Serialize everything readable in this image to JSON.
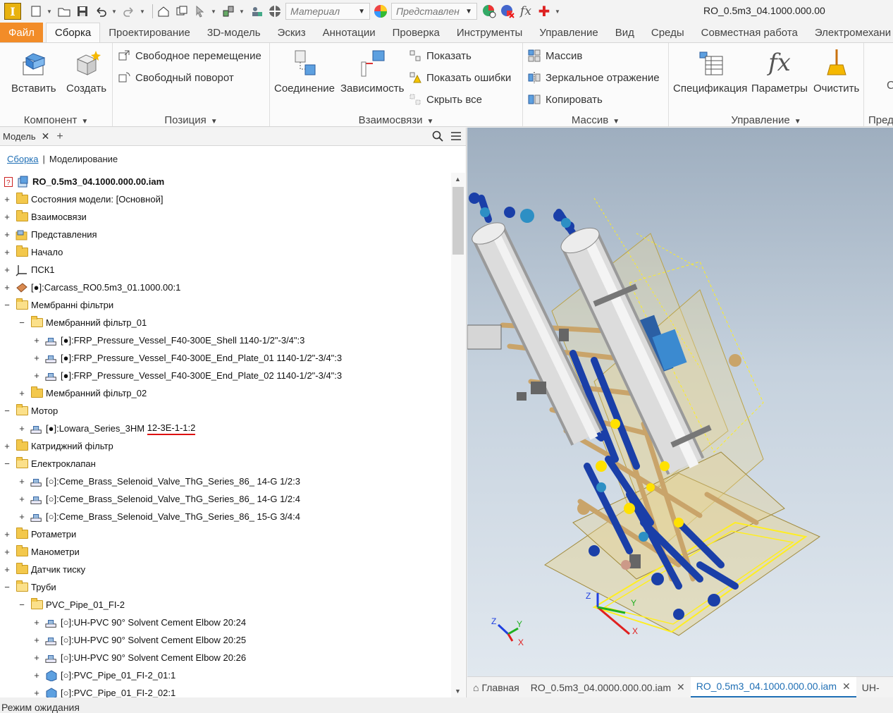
{
  "qat": {
    "material_placeholder": "Материал",
    "representation_placeholder": "Представлен",
    "document_title": "RO_0.5m3_04.1000.000.00"
  },
  "ribbon_tabs": [
    "Файл",
    "Сборка",
    "Проектирование",
    "3D-модель",
    "Эскиз",
    "Аннотации",
    "Проверка",
    "Инструменты",
    "Управление",
    "Вид",
    "Среды",
    "Совместная работа",
    "Электромехани"
  ],
  "ribbon": {
    "component": {
      "insert": "Вставить",
      "create": "Создать",
      "label": "Компонент"
    },
    "position": {
      "free_move": "Свободное перемещение",
      "free_rotate": "Свободный поворот",
      "label": "Позиция"
    },
    "relationships": {
      "joint": "Соединение",
      "constraint": "Зависимость",
      "show": "Показать",
      "show_errors": "Показать ошибки",
      "hide_all": "Скрыть все",
      "label": "Взаимосвязи"
    },
    "pattern": {
      "array": "Массив",
      "mirror": "Зеркальное отражение",
      "copy": "Копировать",
      "label": "Массив"
    },
    "manage": {
      "bom": "Спецификация",
      "params": "Параметры",
      "clean": "Очистить",
      "label": "Управление"
    },
    "next_group_label": "Пред"
  },
  "browser": {
    "tab": "Модель",
    "subtab_assembly": "Сборка",
    "subtab_modeling": "Моделирование",
    "tree": [
      {
        "label": "RO_0.5m3_04.1000.000.00.iam",
        "level": 0,
        "icon": "assembly",
        "exp": "none",
        "root": true
      },
      {
        "label": "Состояния модели: [Основной]",
        "level": 0,
        "icon": "folder",
        "exp": "plus"
      },
      {
        "label": "Взаимосвязи",
        "level": 0,
        "icon": "folder",
        "exp": "plus"
      },
      {
        "label": "Представления",
        "level": 0,
        "icon": "folder-views",
        "exp": "plus"
      },
      {
        "label": "Начало",
        "level": 0,
        "icon": "folder",
        "exp": "plus"
      },
      {
        "label": "ПСК1",
        "level": 0,
        "icon": "ucs",
        "exp": "plus"
      },
      {
        "label": "[●]:Carcass_RO0.5m3_01.1000.00:1",
        "level": 0,
        "icon": "part-frame",
        "exp": "plus"
      },
      {
        "label": "Мембранні фільтри",
        "level": 0,
        "icon": "folder-open",
        "exp": "minus"
      },
      {
        "label": "Мембранний фільтр_01",
        "level": 1,
        "icon": "folder-open",
        "exp": "minus"
      },
      {
        "label": "[●]:FRP_Pressure_Vessel_F40-300E_Shell 1140-1/2\"-3/4\":3",
        "level": 2,
        "icon": "cc-part",
        "exp": "plus"
      },
      {
        "label": "[●]:FRP_Pressure_Vessel_F40-300E_End_Plate_01 1140-1/2\"-3/4\":3",
        "level": 2,
        "icon": "cc-part",
        "exp": "plus"
      },
      {
        "label": "[●]:FRP_Pressure_Vessel_F40-300E_End_Plate_02 1140-1/2\"-3/4\":3",
        "level": 2,
        "icon": "cc-part",
        "exp": "plus"
      },
      {
        "label": "Мембранний фільтр_02",
        "level": 1,
        "icon": "folder",
        "exp": "plus"
      },
      {
        "label": "Мотор",
        "level": 0,
        "icon": "folder-open",
        "exp": "minus"
      },
      {
        "label_a": "[●]:Lowara_Series_3HM ",
        "label_b": "12-3E-1-1:2",
        "level": 1,
        "icon": "cc-part",
        "exp": "plus",
        "underline": true
      },
      {
        "label": "Катриджний фільтр",
        "level": 0,
        "icon": "folder",
        "exp": "plus"
      },
      {
        "label": "Електроклапан",
        "level": 0,
        "icon": "folder-open",
        "exp": "minus"
      },
      {
        "label": "[○]:Ceme_Brass_Selenoid_Valve_ThG_Series_86_ 14-G 1/2:3",
        "level": 1,
        "icon": "cc-part",
        "exp": "plus"
      },
      {
        "label": "[○]:Ceme_Brass_Selenoid_Valve_ThG_Series_86_ 14-G 1/2:4",
        "level": 1,
        "icon": "cc-part",
        "exp": "plus"
      },
      {
        "label": "[○]:Ceme_Brass_Selenoid_Valve_ThG_Series_86_ 15-G 3/4:4",
        "level": 1,
        "icon": "cc-part",
        "exp": "plus"
      },
      {
        "label": "Ротаметри",
        "level": 0,
        "icon": "folder",
        "exp": "plus"
      },
      {
        "label": "Манометри",
        "level": 0,
        "icon": "folder",
        "exp": "plus"
      },
      {
        "label": "Датчик тиску",
        "level": 0,
        "icon": "folder",
        "exp": "plus"
      },
      {
        "label": "Труби",
        "level": 0,
        "icon": "folder-open",
        "exp": "minus"
      },
      {
        "label": "PVC_Pipe_01_FI-2",
        "level": 1,
        "icon": "folder-open",
        "exp": "minus"
      },
      {
        "label": "[○]:UH-PVC 90° Solvent Cement Elbow 20:24",
        "level": 2,
        "icon": "cc-part",
        "exp": "plus"
      },
      {
        "label": "[○]:UH-PVC 90° Solvent Cement Elbow 20:25",
        "level": 2,
        "icon": "cc-part",
        "exp": "plus"
      },
      {
        "label": "[○]:UH-PVC 90° Solvent Cement Elbow 20:26",
        "level": 2,
        "icon": "cc-part",
        "exp": "plus"
      },
      {
        "label": "[○]:PVC_Pipe_01_FI-2_01:1",
        "level": 2,
        "icon": "part",
        "exp": "plus"
      },
      {
        "label": "[○]:PVC_Pipe_01_FI-2_02:1",
        "level": 2,
        "icon": "part",
        "exp": "plus"
      }
    ]
  },
  "viewport": {
    "triad": {
      "x": "X",
      "y": "Y",
      "z": "Z"
    }
  },
  "doc_tabs": {
    "home": "Главная",
    "tab1": "RO_0.5m3_04.0000.000.00.iam",
    "tab2": "RO_0.5m3_04.1000.000.00.iam",
    "tab3": "UH-"
  },
  "status": "Режим ожидания",
  "colors": {
    "accent": "#1f6fb5",
    "file_tab": "#f28c28",
    "folder": "#f3c84c",
    "pipe_blue": "#1a3fa8",
    "sketch_yellow": "#ffee22"
  }
}
